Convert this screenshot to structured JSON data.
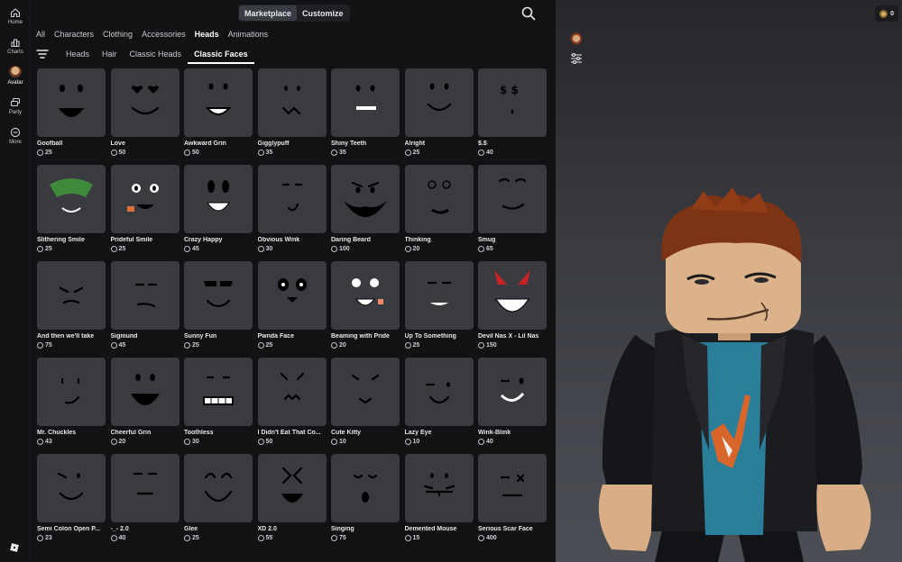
{
  "rail": {
    "items": [
      {
        "label": "Home",
        "icon": "home-icon"
      },
      {
        "label": "Charts",
        "icon": "charts-icon"
      },
      {
        "label": "Avatar",
        "icon": "avatar-icon"
      },
      {
        "label": "Party",
        "icon": "party-icon"
      },
      {
        "label": "More",
        "icon": "more-icon"
      }
    ]
  },
  "topbar": {
    "segment": [
      "Marketplace",
      "Customize"
    ],
    "active_segment": "Marketplace"
  },
  "categories": [
    "All",
    "Characters",
    "Clothing",
    "Accessories",
    "Heads",
    "Animations"
  ],
  "active_category": "Heads",
  "subcategories": [
    "Heads",
    "Hair",
    "Classic Heads",
    "Classic Faces"
  ],
  "active_subcategory": "Classic Faces",
  "items": [
    {
      "name": "Goofball",
      "price": "25"
    },
    {
      "name": "Love",
      "price": "50"
    },
    {
      "name": "Awkward Grin",
      "price": "50"
    },
    {
      "name": "Gigglypuff",
      "price": "35"
    },
    {
      "name": "Shiny Teeth",
      "price": "35"
    },
    {
      "name": "Alright",
      "price": "25"
    },
    {
      "name": "$.$",
      "price": "40"
    },
    {
      "name": "Slithering Smile",
      "price": "25"
    },
    {
      "name": "Prideful Smile",
      "price": "25"
    },
    {
      "name": "Crazy Happy",
      "price": "45"
    },
    {
      "name": "Obvious Wink",
      "price": "30"
    },
    {
      "name": "Daring Beard",
      "price": "100"
    },
    {
      "name": "Thinking",
      "price": "20"
    },
    {
      "name": "Smug",
      "price": "65"
    },
    {
      "name": "And then we'll take",
      "price": "75"
    },
    {
      "name": "Sigmund",
      "price": "45"
    },
    {
      "name": "Sunny Fun",
      "price": "25"
    },
    {
      "name": "Pwnda Face",
      "price": "25"
    },
    {
      "name": "Beaming with Pride",
      "price": "20"
    },
    {
      "name": "Up To Something",
      "price": "25"
    },
    {
      "name": "Devil Nas X - Lil Nas",
      "price": "150"
    },
    {
      "name": "Mr. Chuckles",
      "price": "43"
    },
    {
      "name": "Cheerful Grin",
      "price": "20"
    },
    {
      "name": "Toothless",
      "price": "30"
    },
    {
      "name": "I Didn't Eat That Co...",
      "price": "50"
    },
    {
      "name": "Cute Kitty",
      "price": "10"
    },
    {
      "name": "Lazy Eye",
      "price": "10"
    },
    {
      "name": "Wink-Blink",
      "price": "40"
    },
    {
      "name": "Semi Colon Open P...",
      "price": "23"
    },
    {
      "name": "-_- 2.0",
      "price": "40"
    },
    {
      "name": "Glee",
      "price": "25"
    },
    {
      "name": "XD 2.0",
      "price": "55"
    },
    {
      "name": "Singing",
      "price": "75"
    },
    {
      "name": "Demented Mouse",
      "price": "15"
    },
    {
      "name": "Serious Scar Face",
      "price": "400"
    }
  ],
  "robux_balance": "0"
}
